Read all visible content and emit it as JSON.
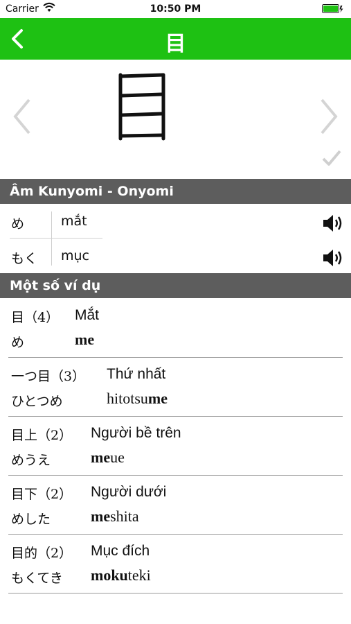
{
  "status": {
    "carrier": "Carrier",
    "time": "10:50 PM"
  },
  "nav": {
    "title": "目"
  },
  "sections": {
    "readings": "Âm Kunyomi - Onyomi",
    "examples": "Một số ví dụ"
  },
  "readings": [
    {
      "kana": "め",
      "meaning": "mắt"
    },
    {
      "kana": "もく",
      "meaning": "mục"
    }
  ],
  "examples": [
    {
      "kanji": "目（4）",
      "meaning": "Mắt",
      "kana": "め",
      "romaji_bold": "me",
      "romaji_rest": ""
    },
    {
      "kanji": "一つ目（3）",
      "meaning": "Thứ nhất",
      "kana": "ひとつめ",
      "romaji_pre": "hitotsu",
      "romaji_bold": "me",
      "romaji_rest": ""
    },
    {
      "kanji": "目上（2）",
      "meaning": "Người bề trên",
      "kana": "めうえ",
      "romaji_bold": "me",
      "romaji_rest": "ue"
    },
    {
      "kanji": "目下（2）",
      "meaning": "Người dưới",
      "kana": "めした",
      "romaji_bold": "me",
      "romaji_rest": "shita"
    },
    {
      "kanji": "目的（2）",
      "meaning": "Mục đích",
      "kana": "もくてき",
      "romaji_bold": "moku",
      "romaji_rest": "teki"
    }
  ],
  "colors": {
    "nav": "#1ec113",
    "section": "#5d5d5d"
  }
}
